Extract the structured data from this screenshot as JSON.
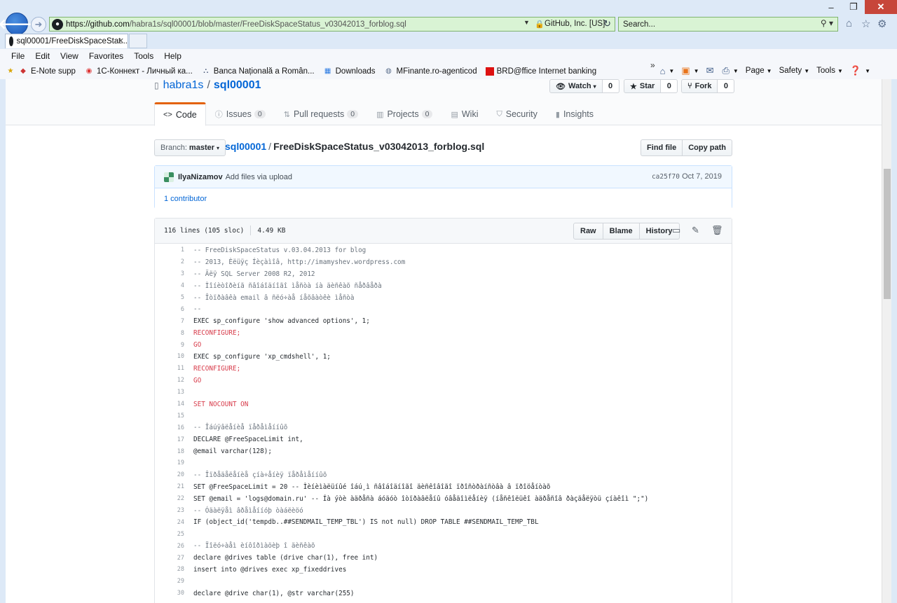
{
  "browser": {
    "url_host": "https://github.com",
    "url_path": "/habra1s/sql00001/blob/master/FreeDiskSpaceStatus_v03042013_forblog.sql",
    "cert_label": "GitHub, Inc. [US]",
    "search_placeholder": "Search...",
    "tab_title": "sql00001/FreeDiskSpaceStat...",
    "menu": [
      "File",
      "Edit",
      "View",
      "Favorites",
      "Tools",
      "Help"
    ],
    "favorites": [
      "E-Note supp",
      "1С-Коннект - Личный ка...",
      "Banca Națională a Român...",
      "Downloads",
      "MFinante.ro-agenticod",
      "BRD@ffice Internet banking"
    ],
    "commands": [
      "Page",
      "Safety",
      "Tools"
    ]
  },
  "repo": {
    "owner": "habra1s",
    "separator": "/",
    "name": "sql00001",
    "social": [
      {
        "label": "Watch",
        "count": "0"
      },
      {
        "label": "Star",
        "count": "0"
      },
      {
        "label": "Fork",
        "count": "0"
      }
    ],
    "tabs": [
      {
        "label": "Code",
        "counter": ""
      },
      {
        "label": "Issues",
        "counter": "0"
      },
      {
        "label": "Pull requests",
        "counter": "0"
      },
      {
        "label": "Projects",
        "counter": "0"
      },
      {
        "label": "Wiki",
        "counter": ""
      },
      {
        "label": "Security",
        "counter": ""
      },
      {
        "label": "Insights",
        "counter": ""
      }
    ]
  },
  "filenav": {
    "branch_label": "Branch:",
    "branch_value": "master",
    "breadcrumb_repo": "sql00001",
    "breadcrumb_sep": "/",
    "breadcrumb_file": "FreeDiskSpaceStatus_v03042013_forblog.sql",
    "find_file": "Find file",
    "copy_path": "Copy path"
  },
  "commit": {
    "author": "IlyaNizamov",
    "message": "Add files via upload",
    "sha": "ca25f70",
    "date": "Oct 7, 2019",
    "contributors": "1 contributor"
  },
  "file": {
    "lines_info": "116 lines (105 sloc)",
    "size": "4.49 KB",
    "buttons": [
      "Raw",
      "Blame",
      "History"
    ]
  },
  "code": [
    {
      "n": "1",
      "t": "-- FreeDiskSpaceStatus v.03.04.2013 for blog",
      "k": "comment"
    },
    {
      "n": "2",
      "t": "-- 2013, Èëüÿç Íèçàìîâ, http://imamyshev.wordpress.com",
      "k": "comment"
    },
    {
      "n": "3",
      "t": "-- Äëÿ SQL Server 2008 R2, 2012",
      "k": "comment"
    },
    {
      "n": "4",
      "t": "-- Ìîíèòîðèíã ñâîáîäíîãî ìåñòà íà äèñêàõ ñåðâåðà",
      "k": "comment"
    },
    {
      "n": "5",
      "t": "-- Îòïðàâêà email â ñëó÷àå íåõâàòêè ìåñòà",
      "k": "comment"
    },
    {
      "n": "6",
      "t": "--",
      "k": "comment"
    },
    {
      "n": "7",
      "t": "EXEC sp_configure 'show advanced options', 1;",
      "k": "normal"
    },
    {
      "n": "8",
      "t": "RECONFIGURE;",
      "k": "keyword"
    },
    {
      "n": "9",
      "t": "GO",
      "k": "keyword"
    },
    {
      "n": "10",
      "t": "EXEC sp_configure 'xp_cmdshell', 1;",
      "k": "normal"
    },
    {
      "n": "11",
      "t": "RECONFIGURE;",
      "k": "keyword"
    },
    {
      "n": "12",
      "t": "GO",
      "k": "keyword"
    },
    {
      "n": "13",
      "t": "",
      "k": "normal"
    },
    {
      "n": "14",
      "t": "SET NOCOUNT ON",
      "k": "keyword"
    },
    {
      "n": "15",
      "t": "",
      "k": "normal"
    },
    {
      "n": "16",
      "t": "-- Îáúÿâëåíèå ïåðåìåííûõ",
      "k": "comment"
    },
    {
      "n": "17",
      "t": "DECLARE @FreeSpaceLimit int,",
      "k": "normal"
    },
    {
      "n": "18",
      "t": "@email varchar(128);",
      "k": "normal"
    },
    {
      "n": "19",
      "t": "",
      "k": "normal"
    },
    {
      "n": "20",
      "t": "-- Îïðåäåëåíèå çíà÷åíèÿ ïåðåìåííûõ",
      "k": "comment"
    },
    {
      "n": "21",
      "t": "SET @FreeSpaceLimit = 20 -- Ìèíèìàëüíûé îáú¸ì ñâîáîäíîãî äèñêîâîãî ïðîñòðàíñòâà â ïðîöåíòàõ",
      "k": "normal"
    },
    {
      "n": "22",
      "t": "SET @email = 'logs@domain.ru' -- Íà ýòè àäðåñà áóäóò îòïðàâëåíû óâåäîìëåíèÿ (íåñêîëüêî àäðåñîâ ðàçäåëÿòü çíàêîì \";\")",
      "k": "normal"
    },
    {
      "n": "23",
      "t": "-- Óäàëÿåì âðåìåííóþ òàáëèöó",
      "k": "comment"
    },
    {
      "n": "24",
      "t": "IF (object_id('tempdb..##SENDMAIL_TEMP_TBL') IS not null) DROP TABLE ##SENDMAIL_TEMP_TBL",
      "k": "normal"
    },
    {
      "n": "25",
      "t": "",
      "k": "normal"
    },
    {
      "n": "26",
      "t": "-- Ïîëó÷àåì èíôîðìàöèþ î äèñêàõ",
      "k": "comment"
    },
    {
      "n": "27",
      "t": "declare @drives table (drive char(1), free int)",
      "k": "normal"
    },
    {
      "n": "28",
      "t": "insert into @drives exec xp_fixeddrives",
      "k": "normal"
    },
    {
      "n": "29",
      "t": "",
      "k": "normal"
    },
    {
      "n": "30",
      "t": "declare @drive char(1), @str varchar(255)",
      "k": "normal"
    }
  ]
}
